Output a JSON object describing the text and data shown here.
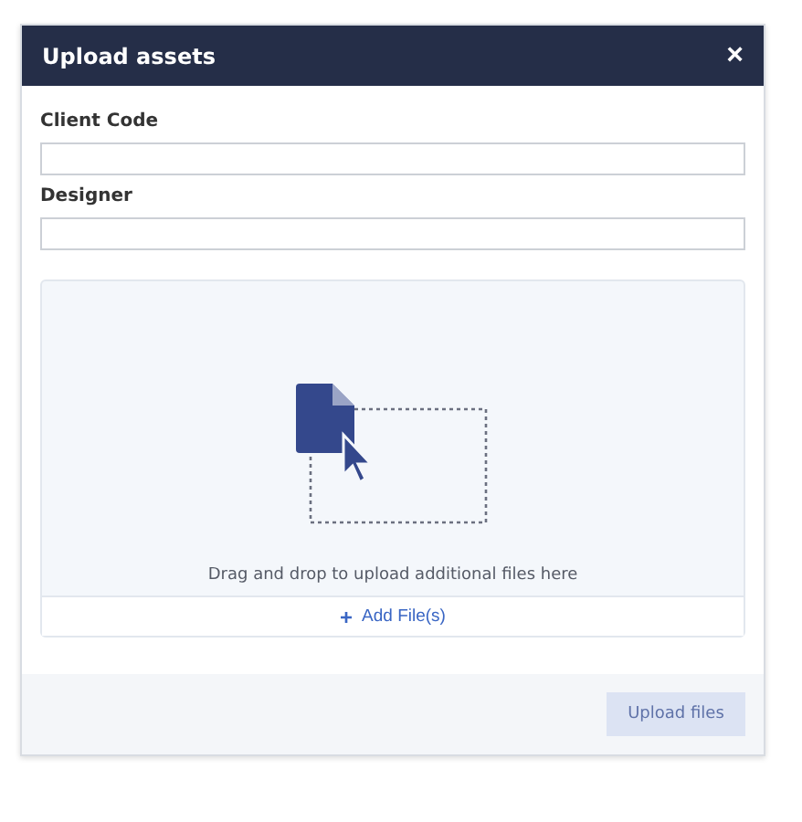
{
  "dialog": {
    "title": "Upload assets",
    "close": "×"
  },
  "fields": [
    {
      "label": "Client Code"
    },
    {
      "label": "Designer"
    }
  ],
  "dropzone": {
    "hint": "Drag and drop to upload additional files here",
    "add_button": {
      "icon": "+",
      "label": "Add File(s)"
    }
  },
  "footer": {
    "upload_button": {
      "label": "Upload files",
      "disabled": true
    }
  }
}
